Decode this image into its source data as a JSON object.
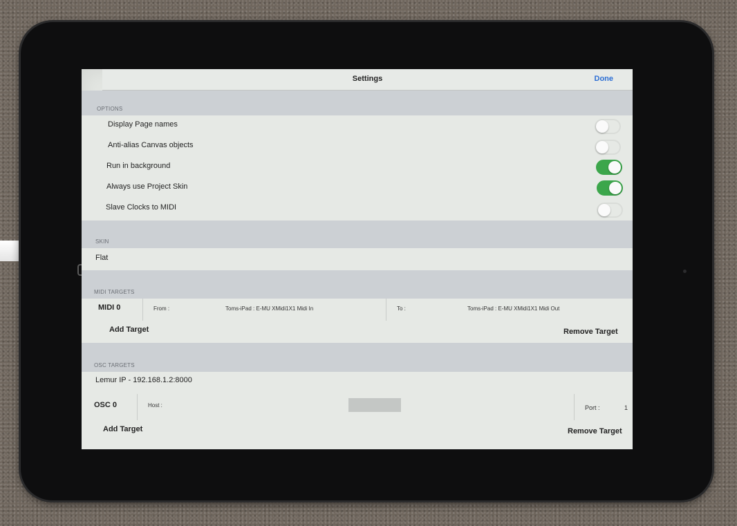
{
  "navbar": {
    "title": "Settings",
    "done_label": "Done"
  },
  "options": {
    "header": "OPTIONS",
    "items": [
      {
        "label": "Display Page names",
        "enabled": false
      },
      {
        "label": "Anti-alias Canvas objects",
        "enabled": false
      },
      {
        "label": "Run in background",
        "enabled": true
      },
      {
        "label": "Always use Project Skin",
        "enabled": true
      },
      {
        "label": "Slave Clocks to MIDI",
        "enabled": false
      }
    ]
  },
  "skin": {
    "header": "SKIN",
    "value": "Flat"
  },
  "midi_targets": {
    "header": "MIDI TARGETS",
    "target_name": "MIDI 0",
    "from_label": "From :",
    "from_value": "Toms-iPad : E-MU XMidi1X1  Midi In",
    "to_label": "To :",
    "to_value": "Toms-iPad : E-MU XMidi1X1 Midi Out",
    "add_label": "Add Target",
    "remove_label": "Remove Target"
  },
  "osc_targets": {
    "header": "OSC TARGETS",
    "lemur_ip": "Lemur IP - 192.168.1.2:8000",
    "target_name": "OSC 0",
    "host_label": "Host :",
    "port_label": "Port :",
    "port_value": "1",
    "add_label": "Add Target",
    "remove_label": "Remove Target"
  },
  "colors": {
    "accent": "#2c6ed4",
    "toggle_on": "#3ca64b",
    "section_bg": "#ccd0d4"
  }
}
